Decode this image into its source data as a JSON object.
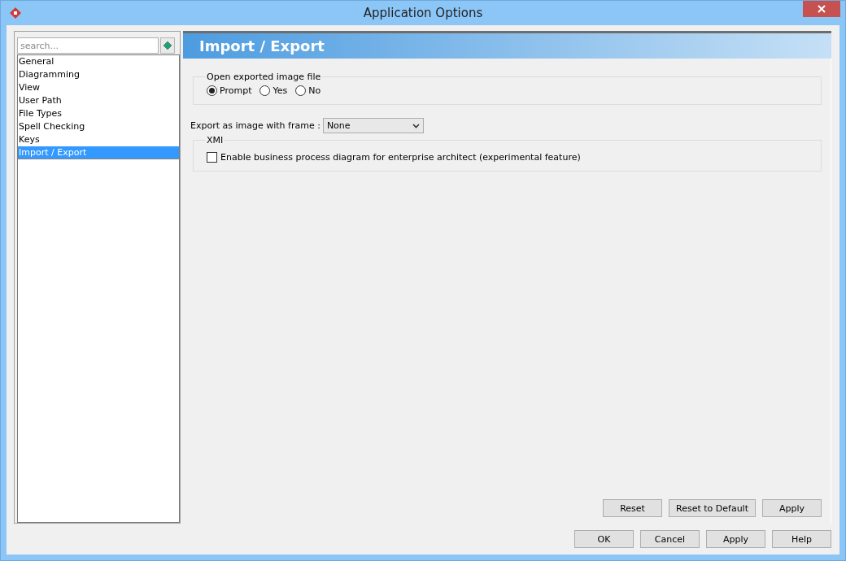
{
  "window": {
    "title": "Application Options"
  },
  "sidebar": {
    "search": {
      "placeholder": "search..."
    },
    "items": [
      {
        "label": "General",
        "selected": false
      },
      {
        "label": "Diagramming",
        "selected": false
      },
      {
        "label": "View",
        "selected": false
      },
      {
        "label": "User Path",
        "selected": false
      },
      {
        "label": "File Types",
        "selected": false
      },
      {
        "label": "Spell Checking",
        "selected": false
      },
      {
        "label": "Keys",
        "selected": false
      },
      {
        "label": "Import / Export",
        "selected": true
      }
    ]
  },
  "panel": {
    "title": "Import / Export",
    "open_group": {
      "legend": "Open exported image file",
      "options": [
        {
          "label": "Prompt",
          "selected": true
        },
        {
          "label": "Yes",
          "selected": false
        },
        {
          "label": "No",
          "selected": false
        }
      ]
    },
    "frame": {
      "label": "Export as image with frame :",
      "value": "None"
    },
    "xmi_group": {
      "legend": "XMI",
      "checkbox": {
        "label": "Enable business process diagram for enterprise architect (experimental feature)",
        "checked": false
      }
    },
    "buttons": [
      "Reset",
      "Reset to Default",
      "Apply"
    ]
  },
  "dialog_buttons": [
    "OK",
    "Cancel",
    "Apply",
    "Help"
  ]
}
